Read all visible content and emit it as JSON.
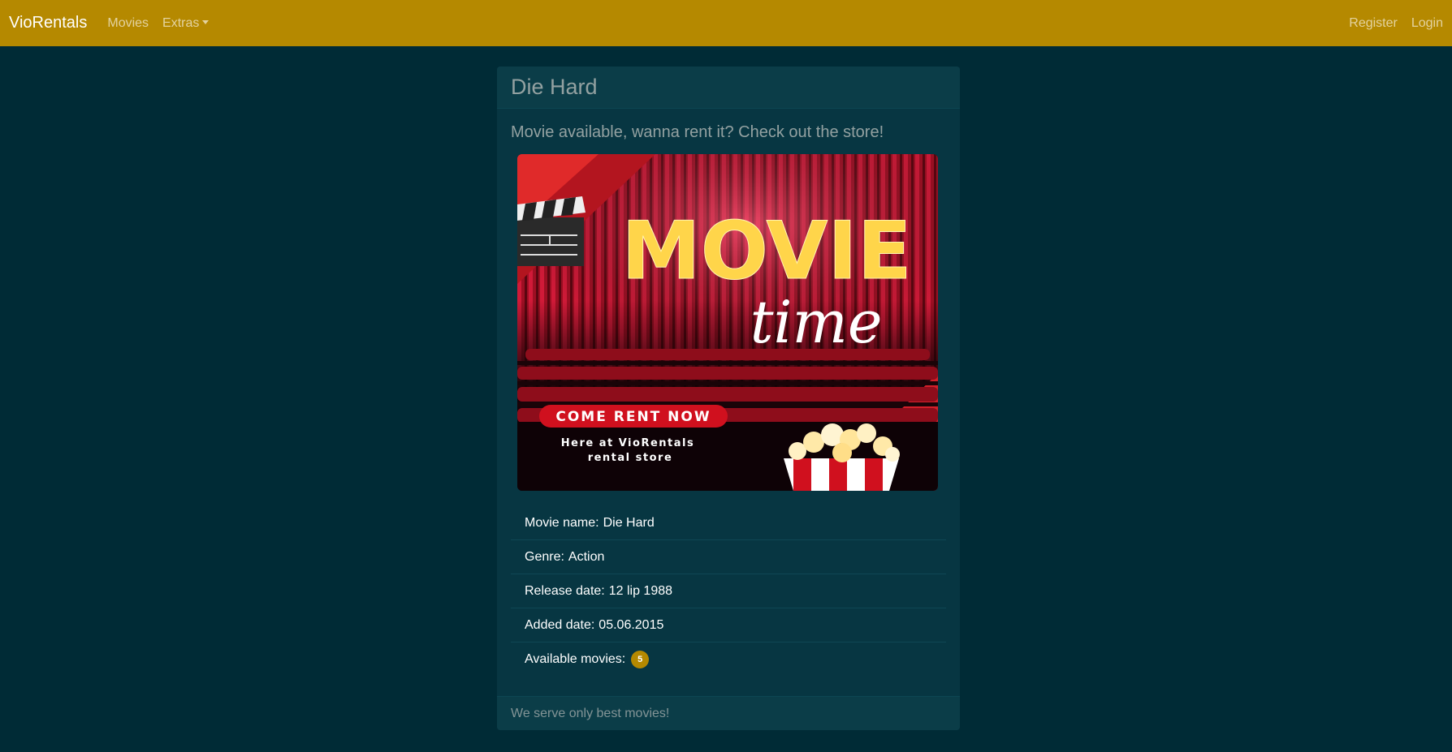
{
  "navbar": {
    "brand": "VioRentals",
    "links": [
      "Movies",
      "Extras"
    ],
    "right_links": [
      "Register",
      "Login"
    ],
    "color": "#b58900"
  },
  "card": {
    "title": "Die Hard",
    "lead": "Movie available, wanna rent it? Check out the store!",
    "poster": {
      "headline": "MOVIE",
      "script": "time",
      "cta": "COME RENT NOW",
      "sub1": "Here at VioRentals",
      "sub2": "rental store"
    },
    "details": [
      {
        "label": "Movie name:",
        "value": "Die Hard"
      },
      {
        "label": "Genre:",
        "value": "Action"
      },
      {
        "label": "Release date:",
        "value": "12 lip 1988"
      },
      {
        "label": "Added date:",
        "value": "05.06.2015"
      }
    ],
    "available_label": "Available movies:",
    "available_count": "5",
    "footer": "We serve only best movies!"
  },
  "colors": {
    "background": "#002b36",
    "card": "#073642",
    "accent": "#b58900"
  }
}
